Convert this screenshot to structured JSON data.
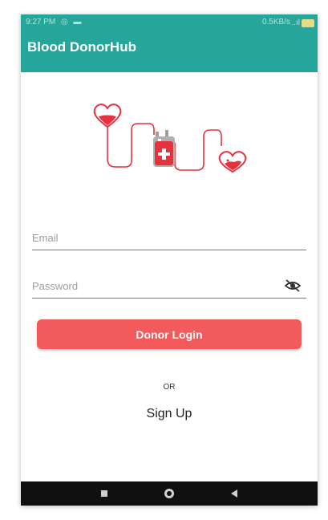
{
  "status_bar": {
    "time": "9:27 PM",
    "notification_icons": "◎ ▬",
    "network_speed": "0.5KB/s",
    "signal": "..ıl",
    "battery_icon": "battery-icon"
  },
  "app_bar": {
    "title": "Blood DonorHub"
  },
  "illustration": {
    "icon": "blood-donation-illustration",
    "colors": {
      "red": "#e8313f",
      "bag_gray": "#9e9e9e"
    }
  },
  "form": {
    "email": {
      "placeholder": "Email",
      "value": ""
    },
    "password": {
      "placeholder": "Password",
      "value": "",
      "toggle_icon": "eye-off-icon"
    },
    "login_label": "Donor Login"
  },
  "or_label": "OR",
  "signup_label": "Sign Up",
  "nav_bar": {
    "recents_icon": "square-icon",
    "home_icon": "circle-icon",
    "back_icon": "triangle-back-icon"
  },
  "colors": {
    "primary": "#26a69a",
    "accent": "#f25a5c",
    "nav_bar": "#101010"
  }
}
